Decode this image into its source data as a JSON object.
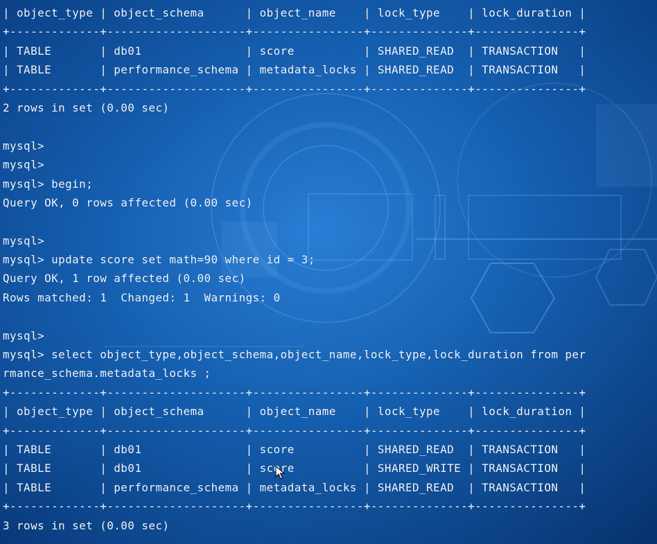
{
  "terminal": {
    "lines": [
      "| object_type | object_schema      | object_name    | lock_type    | lock_duration |",
      "+-------------+--------------------+----------------+--------------+---------------+",
      "| TABLE       | db01               | score          | SHARED_READ  | TRANSACTION   |",
      "| TABLE       | performance_schema | metadata_locks | SHARED_READ  | TRANSACTION   |",
      "+-------------+--------------------+----------------+--------------+---------------+",
      "2 rows in set (0.00 sec)",
      "",
      "mysql>",
      "mysql>",
      "mysql> begin;",
      "Query OK, 0 rows affected (0.00 sec)",
      "",
      "mysql>",
      "mysql> update score set math=90 where id = 3;",
      "Query OK, 1 row affected (0.00 sec)",
      "Rows matched: 1  Changed: 1  Warnings: 0",
      "",
      "mysql>",
      "mysql> select object_type,object_schema,object_name,lock_type,lock_duration from per",
      "rmance_schema.metadata_locks ;",
      "+-------------+--------------------+----------------+--------------+---------------+",
      "| object_type | object_schema      | object_name    | lock_type    | lock_duration |",
      "+-------------+--------------------+----------------+--------------+---------------+",
      "| TABLE       | db01               | score          | SHARED_READ  | TRANSACTION   |",
      "| TABLE       | db01               | score          | SHARED_WRITE | TRANSACTION   |",
      "| TABLE       | performance_schema | metadata_locks | SHARED_READ  | TRANSACTION   |",
      "+-------------+--------------------+----------------+--------------+---------------+",
      "3 rows in set (0.00 sec)"
    ]
  },
  "colors": {
    "text": "#f2f6ff",
    "background": "#0c4a94"
  },
  "icons": {
    "cursor": "mouse-pointer-icon"
  }
}
